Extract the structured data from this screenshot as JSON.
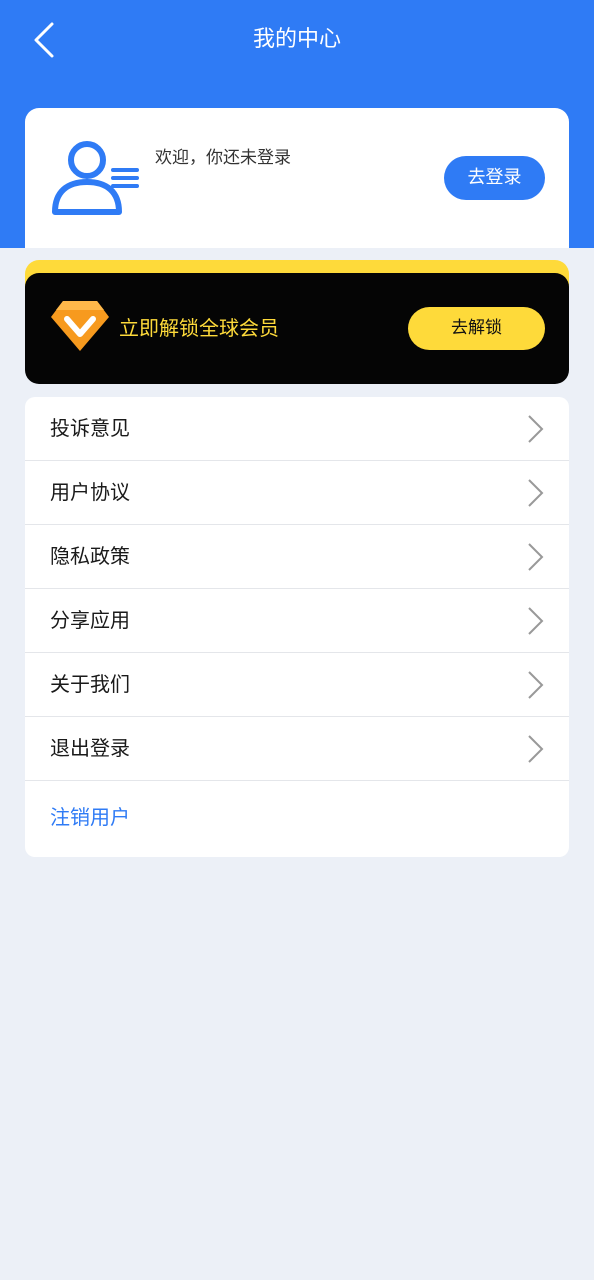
{
  "header": {
    "title": "我的中心",
    "back_icon": "chevron-left-icon"
  },
  "profile": {
    "welcome": "欢迎，你还未登录",
    "login_label": "去登录",
    "avatar_icon": "user-list-icon"
  },
  "vip": {
    "text": "立即解锁全球会员",
    "button_label": "去解锁",
    "icon": "vip-diamond-icon"
  },
  "menu": {
    "items": [
      {
        "label": "投诉意见"
      },
      {
        "label": "用户协议"
      },
      {
        "label": "隐私政策"
      },
      {
        "label": "分享应用"
      },
      {
        "label": "关于我们"
      },
      {
        "label": "退出登录"
      }
    ],
    "cancel_label": "注销用户"
  },
  "colors": {
    "primary": "#2F7BF5",
    "vip_yellow": "#FEDA3A",
    "vip_dark": "#050505",
    "background": "#ECF0F7"
  }
}
